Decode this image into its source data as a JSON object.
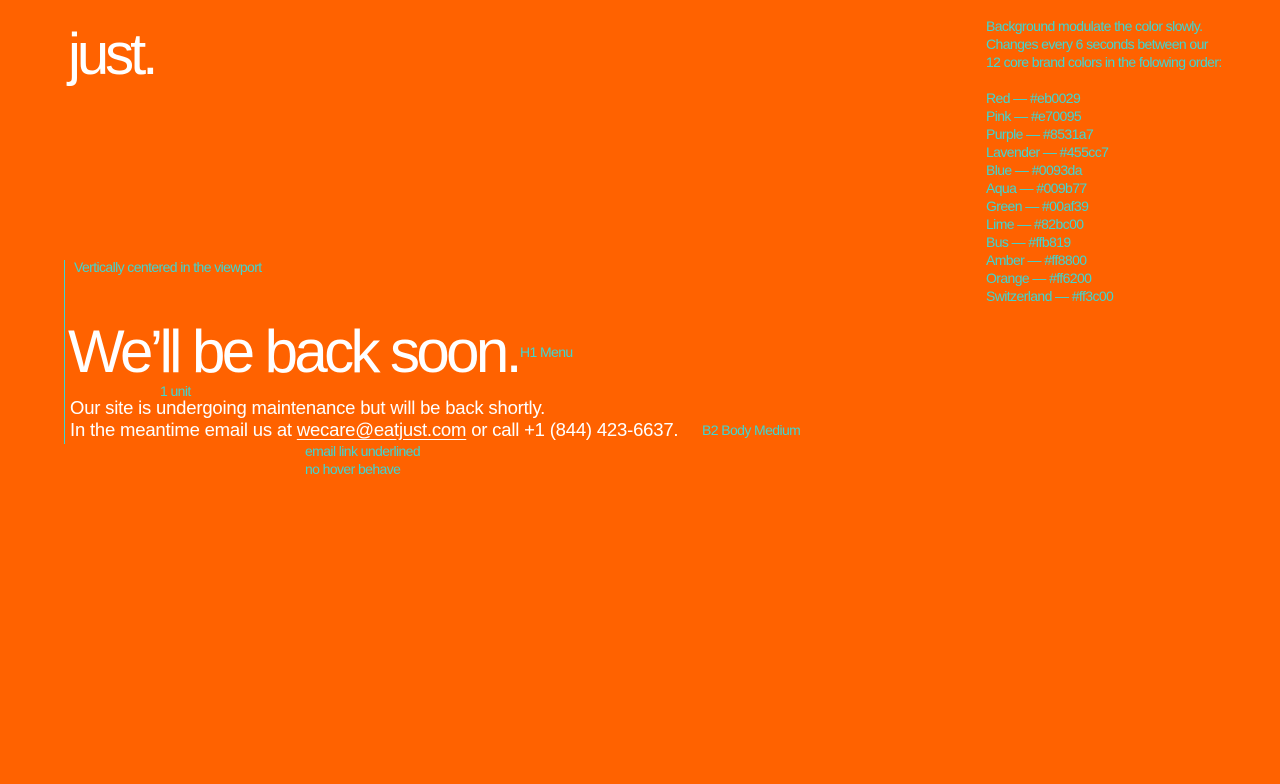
{
  "brand": {
    "logo": "just."
  },
  "annotations": {
    "background_note": [
      "Background modulate the color slowly.",
      "Changes every 6 seconds between our",
      "12 core brand colors in the folowing order:"
    ],
    "colors": [
      {
        "label": "Red — #eb0029",
        "hex": "#eb0029"
      },
      {
        "label": "Pink — #e70095",
        "hex": "#e70095"
      },
      {
        "label": "Purple — #8531a7",
        "hex": "#8531a7"
      },
      {
        "label": "Lavender — #455cc7",
        "hex": "#455cc7"
      },
      {
        "label": "Blue — #0093da",
        "hex": "#0093da"
      },
      {
        "label": "Aqua — #009b77",
        "hex": "#009b77"
      },
      {
        "label": "Green — #00af39",
        "hex": "#00af39"
      },
      {
        "label": "Lime — #82bc00",
        "hex": "#82bc00"
      },
      {
        "label": "Bus — #ffb819",
        "hex": "#ffb819"
      },
      {
        "label": "Amber — #ff8800",
        "hex": "#ff8800"
      },
      {
        "label": "Orange — #ff6200",
        "hex": "#ff6200"
      },
      {
        "label": "Switzerland — #ff3c00",
        "hex": "#ff3c00"
      }
    ],
    "vertical_center": "Vertically centered in the viewport",
    "h1_style": "H1 Menu",
    "unit": "1 unit",
    "body_style": "B2 Body Medium",
    "email_link_note_1": "email link underlined",
    "email_link_note_2": "no hover behave"
  },
  "main": {
    "headline": "We’ll be back soon.",
    "line1": "Our site is undergoing maintenance but will be back shortly.",
    "line2_prefix": "In the meantime email us at",
    "email": "wecare@eatjust.com",
    "line2_suffix": "or call +1 (844) 423-6637."
  },
  "theme": {
    "background": "#ff6200",
    "text": "#ffffff",
    "annotation": "#3fd6d1"
  }
}
